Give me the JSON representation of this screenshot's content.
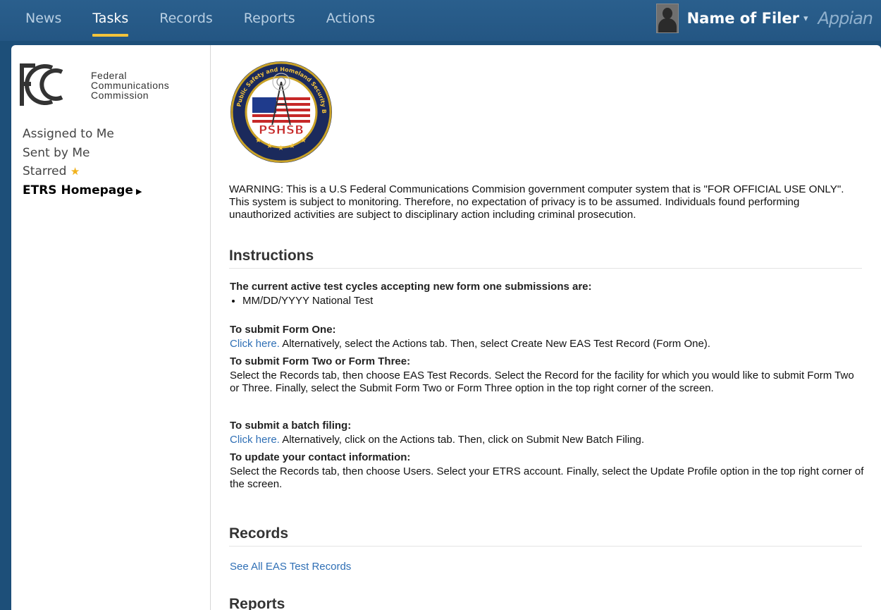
{
  "nav": {
    "items": [
      {
        "label": "News"
      },
      {
        "label": "Tasks"
      },
      {
        "label": "Records"
      },
      {
        "label": "Reports"
      },
      {
        "label": "Actions"
      }
    ],
    "active": "Tasks",
    "user_name": "Name of Filer",
    "brand": "Appian"
  },
  "colors": {
    "nav_bg": "#245683",
    "accent_underline": "#f3c33b",
    "link": "#2f6fb5"
  },
  "sidebar": {
    "logo_lines": [
      "Federal",
      "Communications",
      "Commission"
    ],
    "logo_mark": "FCC",
    "links": [
      {
        "label": "Assigned to Me"
      },
      {
        "label": "Sent by Me"
      },
      {
        "label": "Starred",
        "icon": "star-icon"
      },
      {
        "label": "ETRS Homepage",
        "active": true,
        "icon": "triangle-right-icon"
      }
    ]
  },
  "main": {
    "seal_text": "PSHSB",
    "seal_ring_text": "Public Safety and Homeland Security Bureau",
    "warning": "WARNING: This is a U.S Federal Communications Commision government computer system that is \"FOR OFFICIAL USE ONLY\". This system is subject to monitoring. Therefore, no expectation of privacy is to be assumed. Individuals found performing unauthorized activities are subject to disciplinary action including criminal prosecution.",
    "instructions_title": "Instructions",
    "cycles_label": "The current active test cycles accepting new form one submissions are:",
    "cycles": [
      "MM/DD/YYYY National Test"
    ],
    "form_one_label": "To submit Form One:",
    "form_one_link": "Click here.",
    "form_one_text": " Alternatively, select the Actions tab.  Then, select Create New EAS Test Record (Form One).",
    "form_two_label": "To submit Form Two or Form Three:",
    "form_two_text": "Select the Records tab, then choose EAS Test Records.  Select the Record for the facility for which you would like to submit Form Two or Three.  Finally, select the Submit Form Two or Form Three option in the top right corner of the screen.",
    "batch_label": "To submit a batch filing:",
    "batch_link": "Click here.",
    "batch_text": " Alternatively, click on the Actions tab.  Then, click on Submit New Batch Filing.",
    "contact_label": "To update your contact information:",
    "contact_text": "Select the Records tab, then choose Users.  Select your ETRS account.  Finally, select the Update Profile option in the top right corner of the screen.",
    "records_title": "Records",
    "records_link": "See All EAS Test Records",
    "reports_title": "Reports"
  }
}
